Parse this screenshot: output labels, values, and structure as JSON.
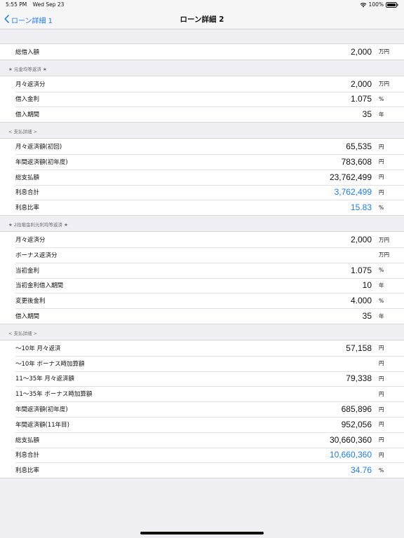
{
  "status": {
    "time": "5:55 PM",
    "date": "Wed Sep 23",
    "battery": "100%"
  },
  "nav": {
    "back_label": "ローン詳細 1",
    "title": "ローン詳細 2"
  },
  "accent_color": "#1b7cf6",
  "top": {
    "rows": [
      {
        "label": "総借入額",
        "value": "2,000",
        "unit": "万円"
      }
    ]
  },
  "sections": [
    {
      "header": "★ 元金均等返済 ★",
      "rows": [
        {
          "label": "月々返済分",
          "value": "2,000",
          "unit": "万円"
        },
        {
          "label": "借入金利",
          "value": "1.075",
          "unit": "%"
        },
        {
          "label": "借入期間",
          "value": "35",
          "unit": "年"
        }
      ]
    },
    {
      "header": "< 支払詳細 >",
      "rows": [
        {
          "label": "月々返済額(初回)",
          "value": "65,535",
          "unit": "円"
        },
        {
          "label": "年間返済額(初年度)",
          "value": "783,608",
          "unit": "円"
        },
        {
          "label": "総支払額",
          "value": "23,762,499",
          "unit": "円"
        },
        {
          "label": "利息合計",
          "value": "3,762,499",
          "unit": "円",
          "blue": true
        },
        {
          "label": "利息比率",
          "value": "15.83",
          "unit": "%",
          "blue": true
        }
      ]
    },
    {
      "header": "★ 2段階金利元利均等返済 ★",
      "rows": [
        {
          "label": "月々返済分",
          "value": "2,000",
          "unit": "万円"
        },
        {
          "label": "ボーナス返済分",
          "value": "",
          "unit": "万円"
        },
        {
          "label": "当初金利",
          "value": "1.075",
          "unit": "%"
        },
        {
          "label": "当初金利借入期間",
          "value": "10",
          "unit": "年"
        },
        {
          "label": "変更後金利",
          "value": "4.000",
          "unit": "%"
        },
        {
          "label": "借入期間",
          "value": "35",
          "unit": "年"
        }
      ]
    },
    {
      "header": "< 支払詳細 >",
      "rows": [
        {
          "label": "〜10年 月々返済",
          "value": "57,158",
          "unit": "円"
        },
        {
          "label": "〜10年 ボーナス時加算額",
          "value": "",
          "unit": "円"
        },
        {
          "label": "11〜35年 月々返済額",
          "value": "79,338",
          "unit": "円"
        },
        {
          "label": "11〜35年 ボーナス時加算額",
          "value": "",
          "unit": "円"
        },
        {
          "label": "年間返済額(初年度)",
          "value": "685,896",
          "unit": "円"
        },
        {
          "label": "年間返済額(11年目)",
          "value": "952,056",
          "unit": "円"
        },
        {
          "label": "総支払額",
          "value": "30,660,360",
          "unit": "円"
        },
        {
          "label": "利息合計",
          "value": "10,660,360",
          "unit": "円",
          "blue": true
        },
        {
          "label": "利息比率",
          "value": "34.76",
          "unit": "%",
          "blue": true
        }
      ]
    }
  ]
}
